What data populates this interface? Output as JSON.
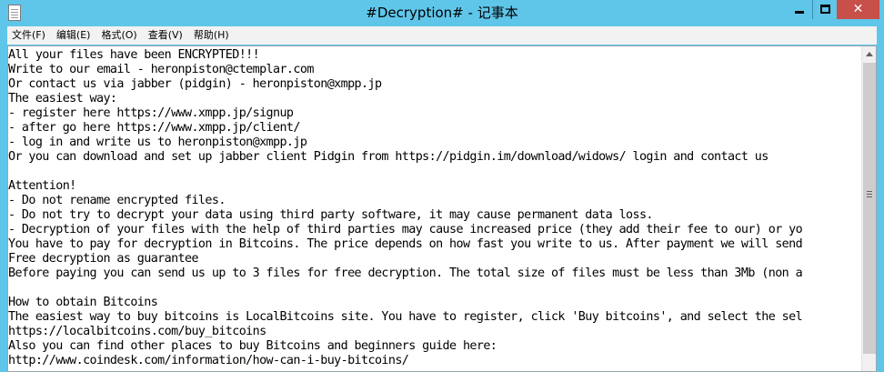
{
  "window": {
    "title": "#Decryption# - 记事本"
  },
  "menu": [
    {
      "label": "文件(F)"
    },
    {
      "label": "编辑(E)"
    },
    {
      "label": "格式(O)"
    },
    {
      "label": "查看(V)"
    },
    {
      "label": "帮助(H)"
    }
  ],
  "controls": {
    "close_glyph": "✕"
  },
  "document": {
    "lines": [
      "All your files have been ENCRYPTED!!!",
      "Write to our email - heronpiston@ctemplar.com",
      "Or contact us via jabber (pidgin) - heronpiston@xmpp.jp",
      "The easiest way:",
      "- register here https://www.xmpp.jp/signup",
      "- after go here https://www.xmpp.jp/client/",
      "- log in and write us to heronpiston@xmpp.jp",
      "Or you can download and set up jabber client Pidgin from https://pidgin.im/download/widows/ login and contact us",
      "",
      "Attention!",
      "- Do not rename encrypted files.",
      "- Do not try to decrypt your data using third party software, it may cause permanent data loss.",
      "- Decryption of your files with the help of third parties may cause increased price (they add their fee to our) or yo",
      "You have to pay for decryption in Bitcoins. The price depends on how fast you write to us. After payment we will send",
      "Free decryption as guarantee",
      "Before paying you can send us up to 3 files for free decryption. The total size of files must be less than 3Mb (non a",
      "",
      "How to obtain Bitcoins",
      "The easiest way to buy bitcoins is LocalBitcoins site. You have to register, click 'Buy bitcoins', and select the sel",
      "https://localbitcoins.com/buy_bitcoins",
      "Also you can find other places to buy Bitcoins and beginners guide here:",
      "http://www.coindesk.com/information/how-can-i-buy-bitcoins/"
    ]
  }
}
